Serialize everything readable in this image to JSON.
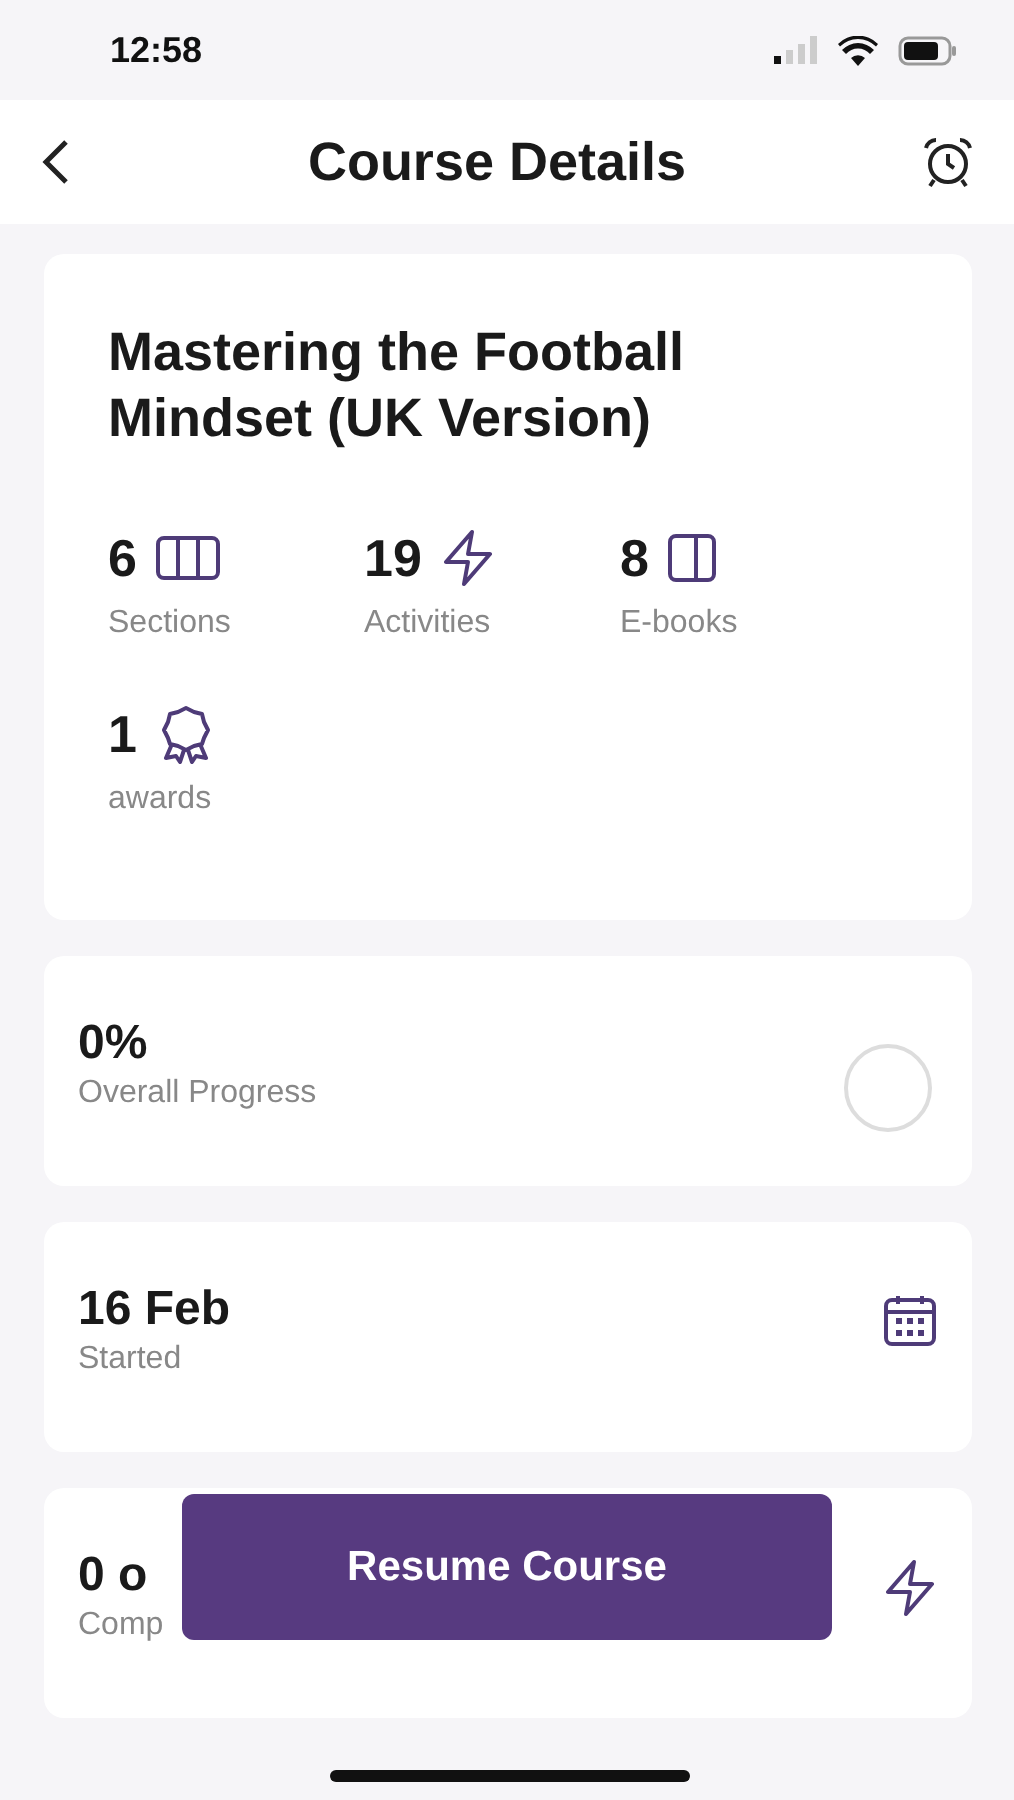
{
  "status_bar": {
    "time": "12:58"
  },
  "header": {
    "title": "Course Details"
  },
  "course": {
    "title": "Mastering the Football Mindset (UK Version)",
    "stats": [
      {
        "value": "6",
        "label": "Sections",
        "kind": "sections"
      },
      {
        "value": "19",
        "label": "Activities",
        "kind": "activities"
      },
      {
        "value": "8",
        "label": "E-books",
        "kind": "ebooks"
      },
      {
        "value": "1",
        "label": "awards",
        "kind": "awards"
      }
    ]
  },
  "info_cards": [
    {
      "value": "0%",
      "label": "Overall Progress",
      "kind": "progress",
      "level": 0
    },
    {
      "value": "16 Feb",
      "label": "Started",
      "kind": "calendar"
    },
    {
      "value": "0 o",
      "label": "Comp",
      "kind": "activity"
    }
  ],
  "resume_button": {
    "label": "Resume Course"
  }
}
